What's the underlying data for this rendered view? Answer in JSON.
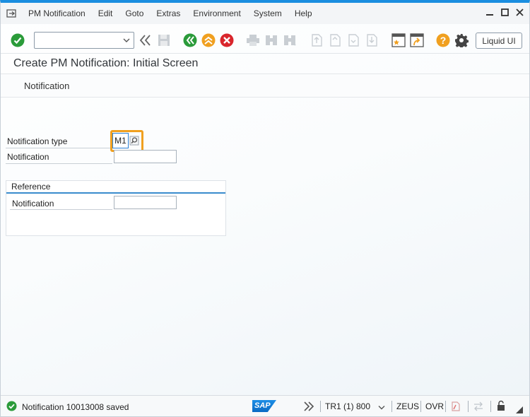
{
  "menu": {
    "items": [
      "PM Notification",
      "Edit",
      "Goto",
      "Extras",
      "Environment",
      "System",
      "Help"
    ]
  },
  "toolbar": {
    "command_value": "",
    "liquid_ui_label": "Liquid UI"
  },
  "screen": {
    "title": "Create PM Notification: Initial Screen",
    "subtitle": "Notification"
  },
  "form": {
    "notification_type_label": "Notification type",
    "notification_type_value": "M1",
    "notification_label": "Notification",
    "notification_value": "",
    "reference": {
      "title": "Reference",
      "notification_label": "Notification",
      "notification_value": ""
    }
  },
  "status": {
    "message": "Notification 10013008 saved",
    "system": "TR1 (1) 800",
    "server": "ZEUS",
    "mode": "OVR",
    "logo": "SAP"
  },
  "colors": {
    "accent": "#1a8ee0",
    "success": "#2b9b3a",
    "warning": "#f0a020",
    "error": "#d9262c"
  }
}
